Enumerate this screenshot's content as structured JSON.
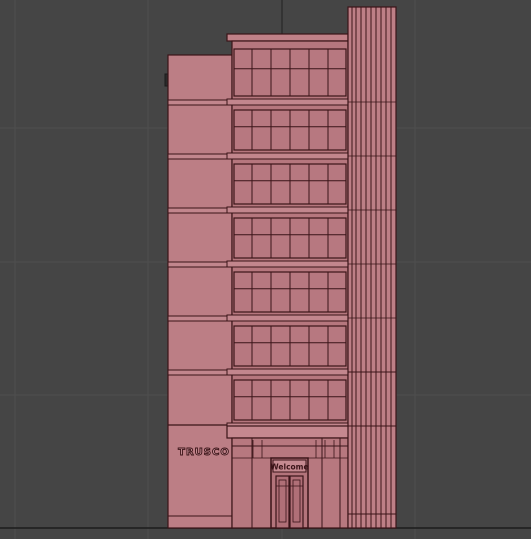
{
  "colors": {
    "background": "#454545",
    "grid_minor": "#4e4e4e",
    "grid_major": "#2a2a2a",
    "facade_fill": "#b97b82",
    "facade_light": "#c2868d",
    "facade_dark": "#9b5f66",
    "line": "#3a1418",
    "glass": "#b77880"
  },
  "building": {
    "brand_sign": "TRUSCO",
    "entrance_sign": "Welcome"
  }
}
